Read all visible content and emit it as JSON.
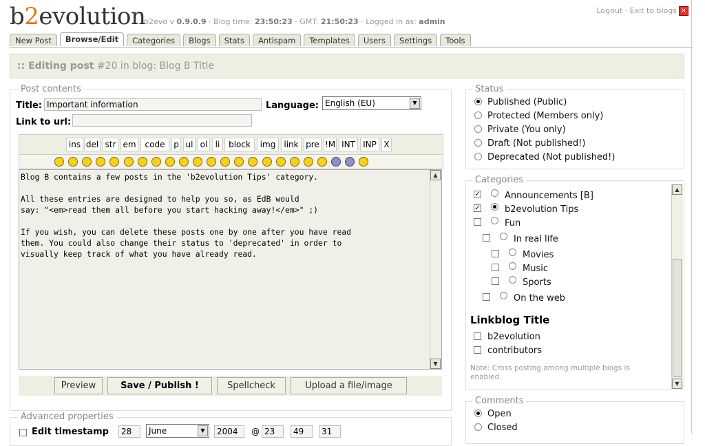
{
  "header": {
    "logo_pre": "b",
    "logo_two": "2",
    "logo_post": "evolution",
    "app_prefix": "b2evo v ",
    "version": "0.9.0.9",
    "blog_time_label": " · Blog time: ",
    "blog_time": "23:50:23",
    "gmt_label": " · GMT: ",
    "gmt": "21:50:23",
    "logged_label": " · Logged in as: ",
    "user": "admin",
    "logout": "Logout",
    "sep": " · ",
    "exit": "Exit to blogs",
    "close_icon": "close-x-icon",
    "close_glyph": "×"
  },
  "tabs": [
    "New Post",
    "Browse/Edit",
    "Categories",
    "Blogs",
    "Stats",
    "Antispam",
    "Templates",
    "Users",
    "Settings",
    "Tools"
  ],
  "active_tab": "Browse/Edit",
  "title_bar": {
    "prefix": ":: Editing post",
    "post_num": " #20",
    "suffix": " in blog: Blog B Title"
  },
  "post": {
    "legend": "Post contents",
    "title_label": "Title:",
    "title_value": "Important information",
    "language_label": "Language:",
    "language_value": "English (EU)",
    "link_label": "Link to url:",
    "link_value": "",
    "content": "Blog B contains a few posts in the 'b2evolution Tips' category.\n\nAll these entries are designed to help you so, as EdB would\nsay: \"<em>read them all before you start hacking away!</em>\" ;)\n\nIf you wish, you can delete these posts one by one after you have read\nthem. You could also change their status to 'deprecated' in order to\nvisually keep track of what you have already read."
  },
  "quicktags": [
    "ins",
    "del",
    "str",
    "em",
    "code",
    "p",
    "ul",
    "ol",
    "li",
    "block",
    "img",
    "link",
    "pre",
    "!M",
    "INT",
    "INP",
    "X"
  ],
  "smilies": [
    "arrow",
    "idea",
    "smile",
    "grin",
    "biggrin",
    "cool",
    "wink",
    "evil",
    "rolleyes",
    "redface",
    "neutral",
    "confused",
    "sad",
    "eek",
    "crazy",
    "mad",
    "hmm",
    "gasp",
    "cry",
    "lalala",
    "alien",
    "puke",
    "dizzy"
  ],
  "buttons": {
    "preview": "Preview",
    "save": "Save / Publish !",
    "spellcheck": "Spellcheck",
    "upload": "Upload a file/image"
  },
  "advanced": {
    "legend": "Advanced properties",
    "edit_timestamp": "Edit timestamp",
    "day": "28",
    "month": "June",
    "year": "2004",
    "at": "@",
    "hour": "23",
    "minute": "49",
    "second": "31"
  },
  "status": {
    "legend": "Status",
    "options": [
      "Published (Public)",
      "Protected (Members only)",
      "Private (You only)",
      "Draft (Not published!)",
      "Deprecated (Not published!)"
    ],
    "selected": 0
  },
  "categories": {
    "legend": "Categories",
    "items": [
      {
        "label": "Announcements [B]",
        "checked": true,
        "main": false,
        "level": 0
      },
      {
        "label": "b2evolution Tips",
        "checked": true,
        "main": true,
        "level": 0
      },
      {
        "label": "Fun",
        "checked": false,
        "main": false,
        "level": 0
      },
      {
        "label": "In real life",
        "checked": false,
        "main": false,
        "level": 1
      },
      {
        "label": "Movies",
        "checked": false,
        "main": false,
        "level": 2
      },
      {
        "label": "Music",
        "checked": false,
        "main": false,
        "level": 2
      },
      {
        "label": "Sports",
        "checked": false,
        "main": false,
        "level": 2
      },
      {
        "label": "On the web",
        "checked": false,
        "main": false,
        "level": 1
      }
    ],
    "linkblog_title": "Linkblog Title",
    "linkblog_items": [
      "b2evolution",
      "contributors"
    ],
    "note": "Note: Cross posting among multiple blogs is enabled."
  },
  "comments": {
    "legend": "Comments",
    "options": [
      "Open",
      "Closed"
    ],
    "selected": 0
  },
  "colors": {
    "accent": "#e07818",
    "panel": "#eeeee2",
    "tab": "#e8e8dc"
  }
}
